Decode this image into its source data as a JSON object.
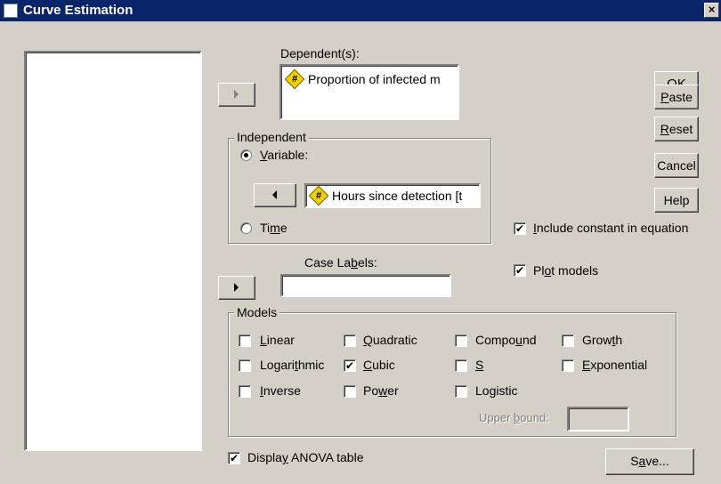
{
  "window": {
    "title": "Curve Estimation",
    "close_glyph": "×"
  },
  "dependent": {
    "label": "Dependent(s):",
    "value": "Proportion of infected m"
  },
  "independent": {
    "group_label": "Independent",
    "variable_radio": "Variable:",
    "variable_value": "Hours since detection [t",
    "time_radio": "Time",
    "selected": "variable"
  },
  "case_labels": {
    "label": "Case Labels:",
    "value": ""
  },
  "buttons": {
    "ok": "OK",
    "paste": "Paste",
    "reset": "Reset",
    "cancel": "Cancel",
    "help": "Help",
    "save": "Save..."
  },
  "options": {
    "include_constant": {
      "label": "Include constant in equation",
      "checked": true
    },
    "plot_models": {
      "label": "Plot models",
      "checked": true
    },
    "display_anova": {
      "label": "Display ANOVA table",
      "checked": true
    }
  },
  "models": {
    "group_label": "Models",
    "linear": {
      "label": "Linear",
      "checked": false
    },
    "quadratic": {
      "label": "Quadratic",
      "checked": false
    },
    "compound": {
      "label": "Compound",
      "checked": false
    },
    "growth": {
      "label": "Growth",
      "checked": false
    },
    "logarithmic": {
      "label": "Logarithmic",
      "checked": false
    },
    "cubic": {
      "label": "Cubic",
      "checked": true
    },
    "s": {
      "label": "S",
      "checked": false
    },
    "exponential": {
      "label": "Exponential",
      "checked": false
    },
    "inverse": {
      "label": "Inverse",
      "checked": false
    },
    "power": {
      "label": "Power",
      "checked": false
    },
    "logistic": {
      "label": "Logistic",
      "checked": false
    },
    "upper_bound": {
      "label": "Upper bound:",
      "value": ""
    }
  },
  "check_glyph": "✔",
  "icons": {
    "variable": "scale-variable-icon",
    "title": "window-icon"
  }
}
